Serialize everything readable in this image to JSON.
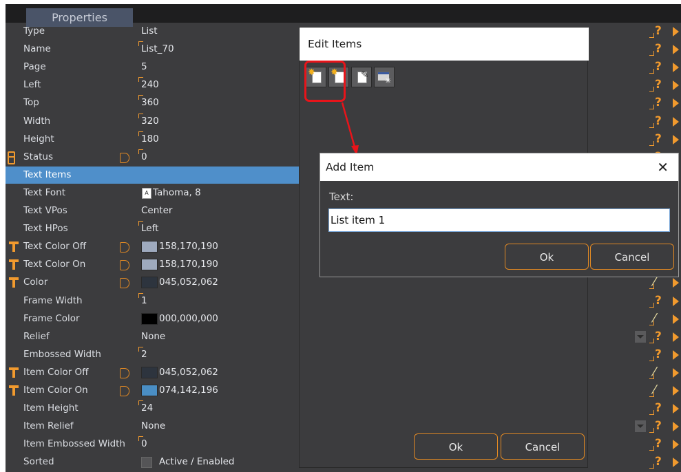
{
  "panel": {
    "title": "Properties"
  },
  "properties": [
    {
      "name": "Type",
      "value": "List",
      "icon": "none",
      "linkable": false,
      "corner": false,
      "right": "help"
    },
    {
      "name": "Name",
      "value": "List_70",
      "icon": "none",
      "linkable": false,
      "corner": true,
      "right": "help"
    },
    {
      "name": "Page",
      "value": "5",
      "icon": "none",
      "linkable": false,
      "corner": false,
      "right": "help"
    },
    {
      "name": "Left",
      "value": "240",
      "icon": "none",
      "linkable": false,
      "corner": true,
      "right": "help"
    },
    {
      "name": "Top",
      "value": "360",
      "icon": "none",
      "linkable": false,
      "corner": true,
      "right": "help"
    },
    {
      "name": "Width",
      "value": "320",
      "icon": "none",
      "linkable": false,
      "corner": true,
      "right": "help"
    },
    {
      "name": "Height",
      "value": "180",
      "icon": "none",
      "linkable": false,
      "corner": true,
      "right": "help"
    },
    {
      "name": "Status",
      "value": "0",
      "icon": "eight-icon",
      "linkable": true,
      "corner": true,
      "right": "help"
    },
    {
      "name": "Text Items",
      "value": "",
      "icon": "none",
      "linkable": false,
      "corner": false,
      "right": "help",
      "selected": true
    },
    {
      "name": "Text Font",
      "value": "Tahoma, 8",
      "icon": "none",
      "linkable": false,
      "corner": false,
      "right": "help",
      "font_icon": "A"
    },
    {
      "name": "Text VPos",
      "value": "Center",
      "icon": "none",
      "linkable": false,
      "corner": false,
      "right": "help"
    },
    {
      "name": "Text HPos",
      "value": "Left",
      "icon": "none",
      "linkable": false,
      "corner": true,
      "right": "help"
    },
    {
      "name": "Text Color Off",
      "value": "158,170,190",
      "icon": "t-icon",
      "linkable": true,
      "corner": false,
      "right": "help",
      "swatch": "#9eaabe"
    },
    {
      "name": "Text Color On",
      "value": "158,170,190",
      "icon": "t-icon",
      "linkable": true,
      "corner": false,
      "right": "help",
      "swatch": "#9eaabe"
    },
    {
      "name": "Color",
      "value": "045,052,062",
      "icon": "t-icon",
      "linkable": true,
      "corner": false,
      "right": "wand",
      "swatch": "#2d343e"
    },
    {
      "name": "Frame Width",
      "value": "1",
      "icon": "none",
      "linkable": false,
      "corner": true,
      "right": "help"
    },
    {
      "name": "Frame Color",
      "value": "000,000,000",
      "icon": "none",
      "linkable": false,
      "corner": false,
      "right": "wand",
      "swatch": "#000000"
    },
    {
      "name": "Relief",
      "value": "None",
      "icon": "none",
      "linkable": false,
      "corner": false,
      "right": "help",
      "dropdown": true
    },
    {
      "name": "Embossed Width",
      "value": "2",
      "icon": "none",
      "linkable": false,
      "corner": true,
      "right": "help"
    },
    {
      "name": "Item Color Off",
      "value": "045,052,062",
      "icon": "t-icon",
      "linkable": true,
      "corner": false,
      "right": "wand",
      "swatch": "#2d343e"
    },
    {
      "name": "Item Color On",
      "value": "074,142,196",
      "icon": "t-icon",
      "linkable": true,
      "corner": false,
      "right": "wand",
      "swatch": "#4a8ec4"
    },
    {
      "name": "Item Height",
      "value": "24",
      "icon": "none",
      "linkable": false,
      "corner": true,
      "right": "help"
    },
    {
      "name": "Item Relief",
      "value": "None",
      "icon": "none",
      "linkable": false,
      "corner": false,
      "right": "help",
      "dropdown": true
    },
    {
      "name": "Item Embossed Width",
      "value": "0",
      "icon": "none",
      "linkable": false,
      "corner": true,
      "right": "help"
    },
    {
      "name": "Sorted",
      "value": "Active / Enabled",
      "icon": "none",
      "linkable": false,
      "corner": false,
      "right": "help",
      "checkbox": true
    }
  ],
  "edit_items": {
    "title": "Edit Items",
    "toolbar": [
      "add-item-icon",
      "insert-item-icon",
      "edit-item-icon",
      "clear-items-icon"
    ],
    "ok_label": "Ok",
    "cancel_label": "Cancel"
  },
  "add_item": {
    "title": "Add Item",
    "close_label": "✕",
    "text_label": "Text:",
    "text_value": "List item 1",
    "ok_label": "Ok",
    "cancel_label": "Cancel"
  },
  "colors": {
    "accent": "#f19a2e",
    "selection": "#4f8fca",
    "annotation": "#e8141a",
    "panel": "#3c3c3e"
  }
}
